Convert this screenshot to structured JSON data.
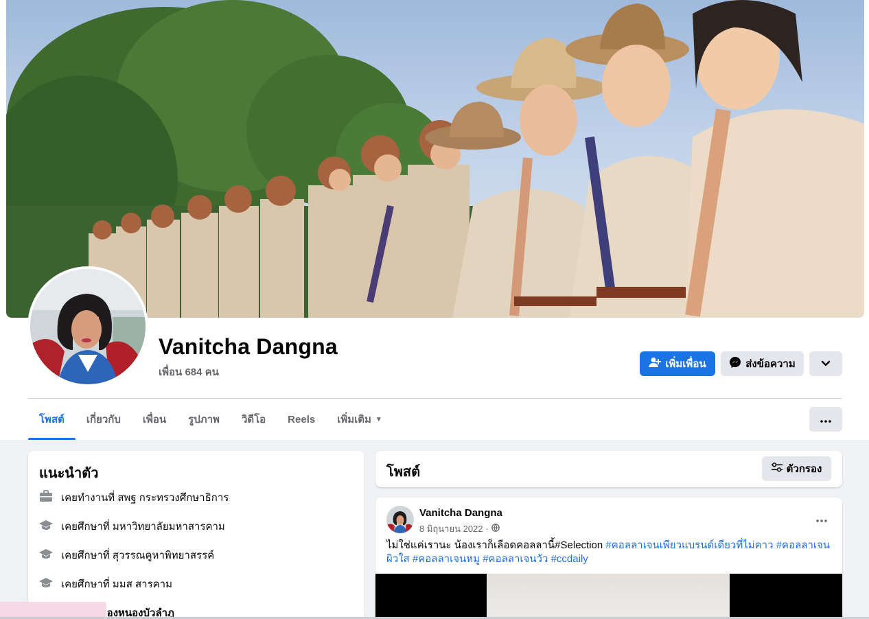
{
  "profile": {
    "name": "Vanitcha Dangna",
    "friends": "เพื่อน 684 คน"
  },
  "actions": {
    "add_friend": "เพิ่มเพื่อน",
    "message": "ส่งข้อความ"
  },
  "tabs": [
    {
      "label": "โพสต์",
      "active": true
    },
    {
      "label": "เกี่ยวกับ",
      "active": false
    },
    {
      "label": "เพื่อน",
      "active": false
    },
    {
      "label": "รูปภาพ",
      "active": false
    },
    {
      "label": "วิดีโอ",
      "active": false
    },
    {
      "label": "Reels",
      "active": false
    },
    {
      "label": "เพิ่มเติม",
      "active": false
    }
  ],
  "intro": {
    "title": "แนะนำตัว",
    "items": [
      {
        "icon": "briefcase-icon",
        "text": "เคยทำงานที่ สพฐ กระทรวงศึกษาธิการ"
      },
      {
        "icon": "graduation-cap-icon",
        "text": "เคยศึกษาที่ มหาวิทยาลัยมหาสารคาม"
      },
      {
        "icon": "graduation-cap-icon",
        "text": "เคยศึกษาที่ สุวรรณคูหาพิทยาสรรค์"
      },
      {
        "icon": "graduation-cap-icon",
        "text": "เคยศึกษาที่ มมส สารคาม"
      },
      {
        "icon": "graduation-cap-icon",
        "text": "เทศบาลเมืองหนองบัวลำภู"
      }
    ]
  },
  "posts_section": {
    "title": "โพสต์",
    "filter_label": "ตัวกรอง"
  },
  "post": {
    "author": "Vanitcha Dangna",
    "date": "8 มิถุนายน 2022",
    "separator": "·",
    "text_plain": "ไม่ใช่แค่เรานะ น้องเราก็เลือดคอลลานี้#Selection",
    "hashtags": [
      "#คอลลาเจนเพียวแบรนด์เดียวที่ไม่คาว",
      "#คอลลาเจนผิวใส",
      "#คอลลาเจนหมู",
      "#คอลลาเจนวัว",
      "#ccdaily"
    ]
  },
  "colors": {
    "accent": "#1b74e4",
    "hashtag": "#216fdb",
    "secondary_text": "#65676b",
    "page_bg": "#f0f2f5"
  }
}
